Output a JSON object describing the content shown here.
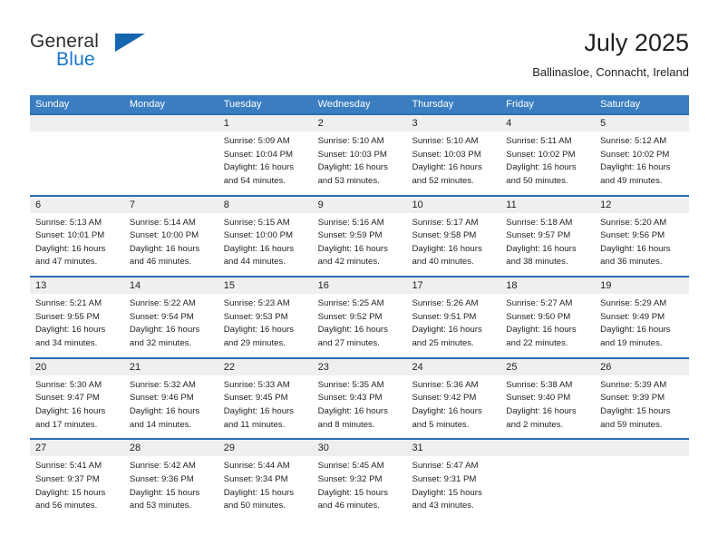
{
  "brand": {
    "name_top": "General",
    "name_bottom": "Blue",
    "color_blue": "#1876c8",
    "color_dark": "#2e2e2e"
  },
  "header": {
    "title": "July 2025",
    "subtitle": "Ballinasloe, Connacht, Ireland"
  },
  "theme": {
    "header_row_bg": "#3a7dc0",
    "row_separator": "#2a6db5",
    "day_band_bg": "#efefef",
    "text": "#231f20"
  },
  "weekdays": [
    "Sunday",
    "Monday",
    "Tuesday",
    "Wednesday",
    "Thursday",
    "Friday",
    "Saturday"
  ],
  "weeks": [
    [
      {
        "day": "",
        "sunrise": "",
        "sunset": "",
        "daylight_1": "",
        "daylight_2": ""
      },
      {
        "day": "",
        "sunrise": "",
        "sunset": "",
        "daylight_1": "",
        "daylight_2": ""
      },
      {
        "day": "1",
        "sunrise": "Sunrise: 5:09 AM",
        "sunset": "Sunset: 10:04 PM",
        "daylight_1": "Daylight: 16 hours",
        "daylight_2": "and 54 minutes."
      },
      {
        "day": "2",
        "sunrise": "Sunrise: 5:10 AM",
        "sunset": "Sunset: 10:03 PM",
        "daylight_1": "Daylight: 16 hours",
        "daylight_2": "and 53 minutes."
      },
      {
        "day": "3",
        "sunrise": "Sunrise: 5:10 AM",
        "sunset": "Sunset: 10:03 PM",
        "daylight_1": "Daylight: 16 hours",
        "daylight_2": "and 52 minutes."
      },
      {
        "day": "4",
        "sunrise": "Sunrise: 5:11 AM",
        "sunset": "Sunset: 10:02 PM",
        "daylight_1": "Daylight: 16 hours",
        "daylight_2": "and 50 minutes."
      },
      {
        "day": "5",
        "sunrise": "Sunrise: 5:12 AM",
        "sunset": "Sunset: 10:02 PM",
        "daylight_1": "Daylight: 16 hours",
        "daylight_2": "and 49 minutes."
      }
    ],
    [
      {
        "day": "6",
        "sunrise": "Sunrise: 5:13 AM",
        "sunset": "Sunset: 10:01 PM",
        "daylight_1": "Daylight: 16 hours",
        "daylight_2": "and 47 minutes."
      },
      {
        "day": "7",
        "sunrise": "Sunrise: 5:14 AM",
        "sunset": "Sunset: 10:00 PM",
        "daylight_1": "Daylight: 16 hours",
        "daylight_2": "and 46 minutes."
      },
      {
        "day": "8",
        "sunrise": "Sunrise: 5:15 AM",
        "sunset": "Sunset: 10:00 PM",
        "daylight_1": "Daylight: 16 hours",
        "daylight_2": "and 44 minutes."
      },
      {
        "day": "9",
        "sunrise": "Sunrise: 5:16 AM",
        "sunset": "Sunset: 9:59 PM",
        "daylight_1": "Daylight: 16 hours",
        "daylight_2": "and 42 minutes."
      },
      {
        "day": "10",
        "sunrise": "Sunrise: 5:17 AM",
        "sunset": "Sunset: 9:58 PM",
        "daylight_1": "Daylight: 16 hours",
        "daylight_2": "and 40 minutes."
      },
      {
        "day": "11",
        "sunrise": "Sunrise: 5:18 AM",
        "sunset": "Sunset: 9:57 PM",
        "daylight_1": "Daylight: 16 hours",
        "daylight_2": "and 38 minutes."
      },
      {
        "day": "12",
        "sunrise": "Sunrise: 5:20 AM",
        "sunset": "Sunset: 9:56 PM",
        "daylight_1": "Daylight: 16 hours",
        "daylight_2": "and 36 minutes."
      }
    ],
    [
      {
        "day": "13",
        "sunrise": "Sunrise: 5:21 AM",
        "sunset": "Sunset: 9:55 PM",
        "daylight_1": "Daylight: 16 hours",
        "daylight_2": "and 34 minutes."
      },
      {
        "day": "14",
        "sunrise": "Sunrise: 5:22 AM",
        "sunset": "Sunset: 9:54 PM",
        "daylight_1": "Daylight: 16 hours",
        "daylight_2": "and 32 minutes."
      },
      {
        "day": "15",
        "sunrise": "Sunrise: 5:23 AM",
        "sunset": "Sunset: 9:53 PM",
        "daylight_1": "Daylight: 16 hours",
        "daylight_2": "and 29 minutes."
      },
      {
        "day": "16",
        "sunrise": "Sunrise: 5:25 AM",
        "sunset": "Sunset: 9:52 PM",
        "daylight_1": "Daylight: 16 hours",
        "daylight_2": "and 27 minutes."
      },
      {
        "day": "17",
        "sunrise": "Sunrise: 5:26 AM",
        "sunset": "Sunset: 9:51 PM",
        "daylight_1": "Daylight: 16 hours",
        "daylight_2": "and 25 minutes."
      },
      {
        "day": "18",
        "sunrise": "Sunrise: 5:27 AM",
        "sunset": "Sunset: 9:50 PM",
        "daylight_1": "Daylight: 16 hours",
        "daylight_2": "and 22 minutes."
      },
      {
        "day": "19",
        "sunrise": "Sunrise: 5:29 AM",
        "sunset": "Sunset: 9:49 PM",
        "daylight_1": "Daylight: 16 hours",
        "daylight_2": "and 19 minutes."
      }
    ],
    [
      {
        "day": "20",
        "sunrise": "Sunrise: 5:30 AM",
        "sunset": "Sunset: 9:47 PM",
        "daylight_1": "Daylight: 16 hours",
        "daylight_2": "and 17 minutes."
      },
      {
        "day": "21",
        "sunrise": "Sunrise: 5:32 AM",
        "sunset": "Sunset: 9:46 PM",
        "daylight_1": "Daylight: 16 hours",
        "daylight_2": "and 14 minutes."
      },
      {
        "day": "22",
        "sunrise": "Sunrise: 5:33 AM",
        "sunset": "Sunset: 9:45 PM",
        "daylight_1": "Daylight: 16 hours",
        "daylight_2": "and 11 minutes."
      },
      {
        "day": "23",
        "sunrise": "Sunrise: 5:35 AM",
        "sunset": "Sunset: 9:43 PM",
        "daylight_1": "Daylight: 16 hours",
        "daylight_2": "and 8 minutes."
      },
      {
        "day": "24",
        "sunrise": "Sunrise: 5:36 AM",
        "sunset": "Sunset: 9:42 PM",
        "daylight_1": "Daylight: 16 hours",
        "daylight_2": "and 5 minutes."
      },
      {
        "day": "25",
        "sunrise": "Sunrise: 5:38 AM",
        "sunset": "Sunset: 9:40 PM",
        "daylight_1": "Daylight: 16 hours",
        "daylight_2": "and 2 minutes."
      },
      {
        "day": "26",
        "sunrise": "Sunrise: 5:39 AM",
        "sunset": "Sunset: 9:39 PM",
        "daylight_1": "Daylight: 15 hours",
        "daylight_2": "and 59 minutes."
      }
    ],
    [
      {
        "day": "27",
        "sunrise": "Sunrise: 5:41 AM",
        "sunset": "Sunset: 9:37 PM",
        "daylight_1": "Daylight: 15 hours",
        "daylight_2": "and 56 minutes."
      },
      {
        "day": "28",
        "sunrise": "Sunrise: 5:42 AM",
        "sunset": "Sunset: 9:36 PM",
        "daylight_1": "Daylight: 15 hours",
        "daylight_2": "and 53 minutes."
      },
      {
        "day": "29",
        "sunrise": "Sunrise: 5:44 AM",
        "sunset": "Sunset: 9:34 PM",
        "daylight_1": "Daylight: 15 hours",
        "daylight_2": "and 50 minutes."
      },
      {
        "day": "30",
        "sunrise": "Sunrise: 5:45 AM",
        "sunset": "Sunset: 9:32 PM",
        "daylight_1": "Daylight: 15 hours",
        "daylight_2": "and 46 minutes."
      },
      {
        "day": "31",
        "sunrise": "Sunrise: 5:47 AM",
        "sunset": "Sunset: 9:31 PM",
        "daylight_1": "Daylight: 15 hours",
        "daylight_2": "and 43 minutes."
      },
      {
        "day": "",
        "sunrise": "",
        "sunset": "",
        "daylight_1": "",
        "daylight_2": ""
      },
      {
        "day": "",
        "sunrise": "",
        "sunset": "",
        "daylight_1": "",
        "daylight_2": ""
      }
    ]
  ]
}
